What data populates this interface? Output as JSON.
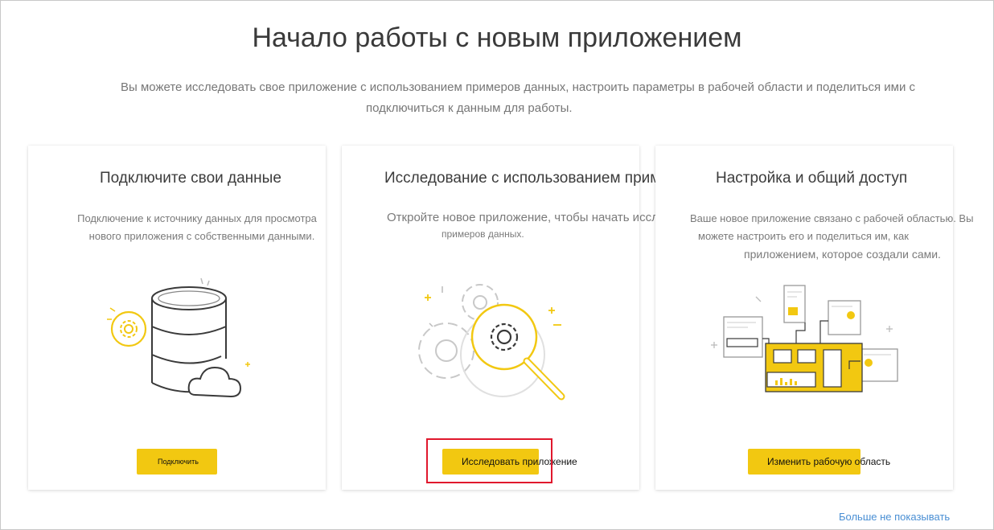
{
  "header": {
    "title": "Начало работы с новым приложением",
    "subtitle_line1": "Вы можете исследовать свое приложение с использованием примеров данных, настроить параметры в рабочей области и поделиться ими с",
    "subtitle_line2": "подключиться к данным для работы."
  },
  "cards": [
    {
      "title": "Подключите свои данные",
      "desc_line1": "Подключение к источнику данных для просмотра",
      "desc_line2": "нового приложения с собственными данными.",
      "button": "Подключить",
      "icon": "database-gear-cloud-icon"
    },
    {
      "title": "Исследование с использованием примеров данных",
      "desc_line1": "Откройте новое приложение, чтобы начать исследование с использованием",
      "desc_line2": "примеров данных.",
      "button": "Исследовать приложение",
      "icon": "gears-magnifier-icon"
    },
    {
      "title": "Настройка и общий доступ",
      "desc_line1": "Ваше новое приложение связано с рабочей областью. Вы",
      "desc_line2": "можете настроить его и поделиться им, как",
      "desc_line3": "приложением, которое создали сами.",
      "button": "Изменить рабочую область",
      "icon": "dashboard-share-icon"
    }
  ],
  "footer": {
    "dismiss_link": "Больше не показывать"
  },
  "colors": {
    "accent": "#f2c811",
    "highlight": "#e0182d",
    "link": "#4a8fd4"
  }
}
